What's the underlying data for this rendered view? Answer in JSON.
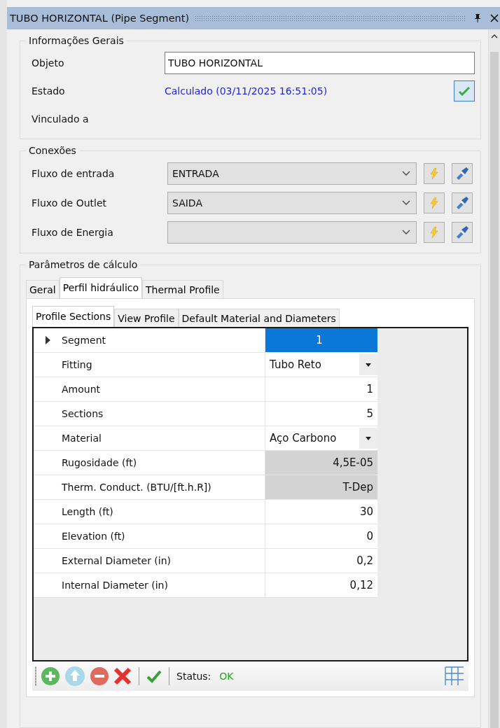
{
  "window": {
    "title": "TUBO HORIZONTAL (Pipe Segment)"
  },
  "general": {
    "title": "Informações Gerais",
    "fields": [
      {
        "label": "Objeto",
        "kind": "input",
        "value": "TUBO HORIZONTAL"
      },
      {
        "label": "Estado",
        "kind": "status",
        "value": "Calculado (03/11/2025 16:51:05)"
      },
      {
        "label": "Vinculado a",
        "kind": "empty"
      }
    ]
  },
  "connections": {
    "title": "Conexões",
    "rows": [
      {
        "label": "Fluxo de entrada",
        "value": "ENTRADA"
      },
      {
        "label": "Fluxo de Outlet",
        "value": "SAIDA"
      },
      {
        "label": "Fluxo de Energia"
      }
    ]
  },
  "calc": {
    "title": "Parâmetros de cálculo",
    "tabs": [
      {
        "label": "Geral",
        "selected": false
      },
      {
        "label": "Perfil hidráulico",
        "selected": true
      },
      {
        "label": "Thermal Profile",
        "selected": false
      }
    ],
    "subtabs": [
      {
        "label": "Profile Sections",
        "selected": true
      },
      {
        "label": "View Profile",
        "selected": false
      },
      {
        "label": "Default Material and Diameters",
        "selected": false
      }
    ],
    "rows": [
      {
        "label": "Segment",
        "value": "1",
        "kind": "number",
        "readonly": false,
        "selected": true
      },
      {
        "label": "Fitting",
        "value": "Tubo Reto",
        "kind": "choice",
        "readonly": false,
        "selected": false
      },
      {
        "label": "Amount",
        "value": "1",
        "kind": "number",
        "readonly": false,
        "selected": false
      },
      {
        "label": "Sections",
        "value": "5",
        "kind": "number",
        "readonly": false,
        "selected": false
      },
      {
        "label": "Material",
        "value": "Aço Carbono",
        "kind": "choice",
        "readonly": false,
        "selected": false
      },
      {
        "label": "Rugosidade (ft)",
        "value": "4,5E-05",
        "kind": "number",
        "readonly": true,
        "selected": false
      },
      {
        "label": "Therm. Conduct. (BTU/[ft.h.R])",
        "value": "T-Dep",
        "kind": "number",
        "readonly": true,
        "selected": false
      },
      {
        "label": "Length (ft)",
        "value": "30",
        "kind": "number",
        "readonly": false,
        "selected": false
      },
      {
        "label": "Elevation (ft)",
        "value": "0",
        "kind": "number",
        "readonly": false,
        "selected": false
      },
      {
        "label": "External Diameter (in)",
        "value": "0,2",
        "kind": "number",
        "readonly": false,
        "selected": false
      },
      {
        "label": "Internal Diameter (in)",
        "value": "0,12",
        "kind": "number",
        "readonly": false,
        "selected": false
      }
    ],
    "status": {
      "label": "Status:",
      "value": "OK"
    }
  }
}
